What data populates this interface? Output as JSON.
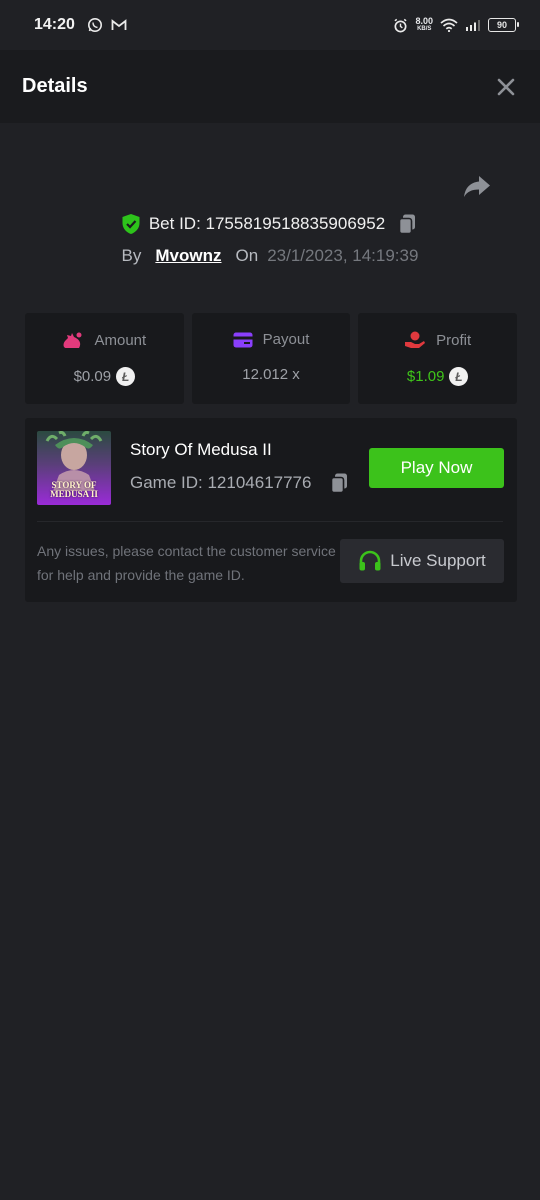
{
  "status_bar": {
    "time": "14:20",
    "net_speed_value": "8.00",
    "net_speed_unit": "KB/S",
    "battery": "90",
    "icons": [
      "whatsapp-icon",
      "gmail-icon",
      "alarm-icon",
      "wifi-icon",
      "signal-icon",
      "battery-icon"
    ]
  },
  "header": {
    "title": "Details"
  },
  "bet": {
    "id_label": "Bet ID: 1755819518835906952",
    "by_label": "By",
    "username": "Mvownz",
    "on_label": "On",
    "datetime": "23/1/2023, 14:19:39"
  },
  "stats": [
    {
      "label": "Amount",
      "value": "$0.09",
      "icon": "money-bag-icon",
      "color": "#e23a7c",
      "coin": "Ł"
    },
    {
      "label": "Payout",
      "value": "12.012 x",
      "icon": "card-icon",
      "color": "#8a3ffc"
    },
    {
      "label": "Profit",
      "value": "$1.09",
      "icon": "hand-coin-icon",
      "color": "#e0393e",
      "coin": "Ł"
    }
  ],
  "game": {
    "thumb_title_line1": "STORY OF",
    "thumb_title_line2": "MEDUSA II",
    "name": "Story Of Medusa II",
    "id_label": "Game ID: 12104617776",
    "play_label": "Play Now",
    "issue_text": "Any issues, please contact the customer service for help and provide the game ID.",
    "support_label": "Live Support"
  },
  "colors": {
    "accent_green": "#3cc21b",
    "profit_green": "#3fc51a",
    "background": "#202125",
    "card": "#18191c"
  }
}
